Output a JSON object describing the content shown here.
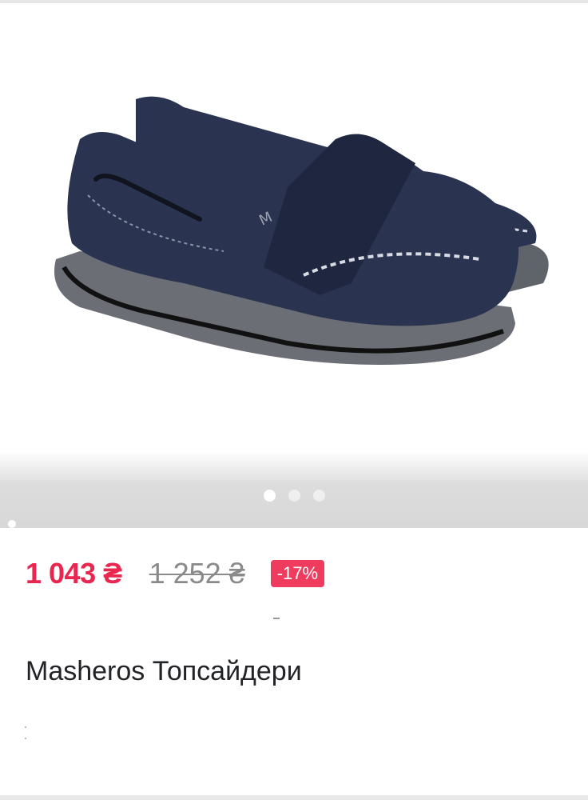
{
  "gallery": {
    "image_name": "shoe-photo",
    "slides_total": 3,
    "active_slide": 1
  },
  "product": {
    "price_current": "1 043 ₴",
    "price_old": "1 252 ₴",
    "discount": "-17%",
    "title": "Masheros Топсайдери"
  },
  "colors": {
    "accent_price": "#e8264f",
    "badge": "#ef3b5e",
    "shoe": "#26304a",
    "sole": "#6b6e74",
    "stitch": "#d8dbe3"
  }
}
